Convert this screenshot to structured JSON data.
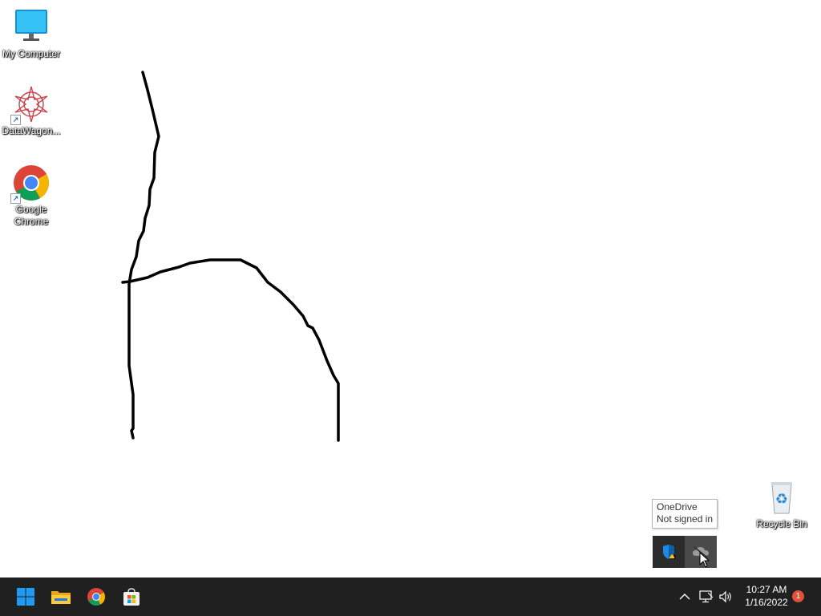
{
  "desktop": {
    "icons": [
      {
        "label": "My Computer"
      },
      {
        "label": "DataWagon..."
      },
      {
        "label": "Google Chrome"
      },
      {
        "label": "Recycle Bin"
      }
    ]
  },
  "tooltip": {
    "title": "OneDrive",
    "status": "Not signed in"
  },
  "tray_popup": {
    "icons": [
      "windows-security-warning-icon",
      "onedrive-cloud-icon"
    ]
  },
  "taskbar": {
    "pinned": [
      "start-icon",
      "file-explorer-icon",
      "chrome-icon",
      "microsoft-store-icon"
    ],
    "time": "10:27 AM",
    "date": "1/16/2022",
    "notification_count": "1"
  },
  "colors": {
    "taskbar": "#202020",
    "accent": "#1e9bf0",
    "notification": "#e0533a"
  }
}
